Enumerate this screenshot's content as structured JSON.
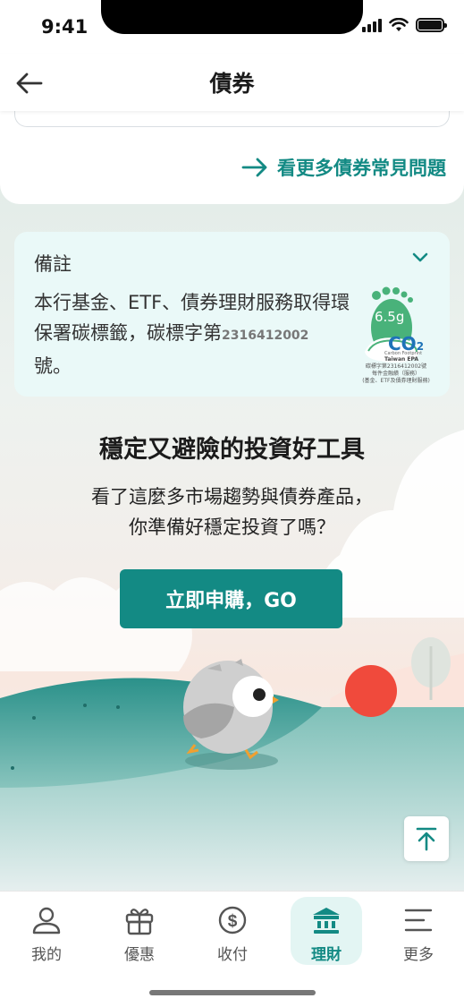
{
  "status_bar": {
    "time": "9:41"
  },
  "header": {
    "title": "債券",
    "back_icon": "arrow-left-icon"
  },
  "faq": {
    "more_link": "看更多債券常見問題",
    "more_icon": "arrow-right-icon"
  },
  "notes": {
    "title": "備註",
    "text_part1": "本行基金、ETF、債券理財服務取得環保署碳標籤，碳標字第",
    "code": "2316412002",
    "text_part2": "號。",
    "carbon_label": {
      "amount": "6.5g",
      "co2": "CO",
      "co2_sub": "2",
      "line1": "Carbon Footprint",
      "line2": "Taiwan EPA",
      "caption1": "碳標字第2316412002號",
      "caption2": "每件金融績（服務）",
      "caption3": "(基金、ETF及債券理財服務)"
    }
  },
  "promo": {
    "title": "穩定又避險的投資好工具",
    "subtitle_line1": "看了這麼多市場趨勢與債券產品，",
    "subtitle_line2": "你準備好穩定投資了嗎？",
    "button": "立即申購，GO"
  },
  "tabs": [
    {
      "label": "我的",
      "icon": "person-icon"
    },
    {
      "label": "優惠",
      "icon": "gift-icon"
    },
    {
      "label": "收付",
      "icon": "dollar-icon"
    },
    {
      "label": "理財",
      "icon": "bank-icon",
      "active": true
    },
    {
      "label": "更多",
      "icon": "menu-icon"
    }
  ],
  "colors": {
    "accent": "#138a84",
    "note_bg": "#eaf9f8",
    "active_tab_bg": "#e3f5f3",
    "sun": "#f04a3c"
  }
}
